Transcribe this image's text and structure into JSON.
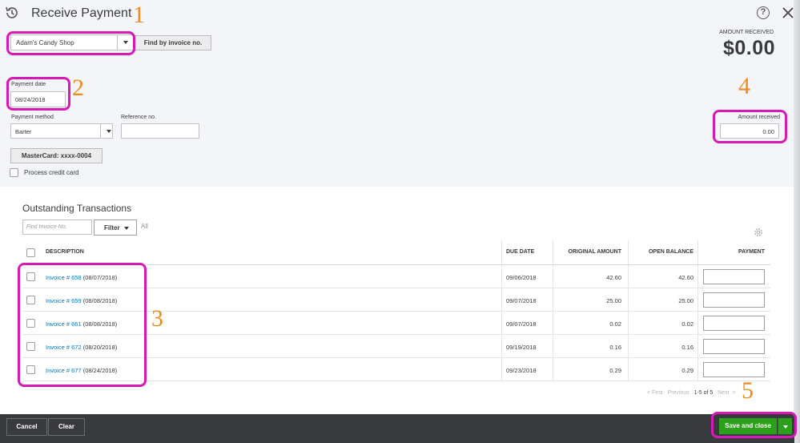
{
  "header": {
    "title": "Receive Payment",
    "history_icon": "history-icon",
    "help_icon_glyph": "?",
    "close_icon": "close-icon"
  },
  "customer": {
    "selected": "Adam's Candy Shop"
  },
  "find_by_invoice_label": "Find by invoice no.",
  "amount_received": {
    "label": "AMOUNT RECEIVED",
    "value": "$0.00"
  },
  "payment_date": {
    "label": "Payment date",
    "value": "08/24/2018"
  },
  "payment_method": {
    "label": "Payment method",
    "value": "Barter"
  },
  "reference": {
    "label": "Reference no.",
    "value": ""
  },
  "amount_field": {
    "label": "Amount received",
    "value": "0.00"
  },
  "mastercard_label": "MasterCard: xxxx-0004",
  "process_credit_card_label": "Process credit card",
  "outstanding": {
    "title": "Outstanding Transactions",
    "find_placeholder": "Find Invoice No.",
    "filter_label": "Filter",
    "all_label": "All",
    "columns": {
      "description": "DESCRIPTION",
      "due_date": "DUE DATE",
      "original_amount": "ORIGINAL AMOUNT",
      "open_balance": "OPEN BALANCE",
      "payment": "PAYMENT"
    },
    "rows": [
      {
        "invoice": "Invoice # 658",
        "date": "(08/07/2018)",
        "due": "09/06/2018",
        "original": "42.60",
        "open": "42.60"
      },
      {
        "invoice": "Invoice # 659",
        "date": "(08/08/2018)",
        "due": "09/07/2018",
        "original": "25.00",
        "open": "25.00"
      },
      {
        "invoice": "Invoice # 661",
        "date": "(08/08/2018)",
        "due": "09/07/2018",
        "original": "0.02",
        "open": "0.02"
      },
      {
        "invoice": "Invoice # 672",
        "date": "(08/20/2018)",
        "due": "09/19/2018",
        "original": "0.16",
        "open": "0.16"
      },
      {
        "invoice": "Invoice # 677",
        "date": "(08/24/2018)",
        "due": "09/23/2018",
        "original": "0.29",
        "open": "0.29"
      }
    ],
    "pagination": {
      "first": "< First",
      "previous": "Previous",
      "range": "1-5 of 5",
      "next": "Next",
      "last": ">"
    }
  },
  "footer": {
    "cancel": "Cancel",
    "clear": "Clear",
    "save_and_close": "Save and close"
  },
  "annotations": {
    "n1": "1",
    "n2": "2",
    "n3": "3",
    "n4": "4",
    "n5": "5"
  },
  "colors": {
    "highlight": "#d61bb4",
    "annotation_number": "#f08a1c",
    "primary_green": "#2ca01c",
    "link_blue": "#0077c5",
    "footer_bg": "#393a3d"
  }
}
